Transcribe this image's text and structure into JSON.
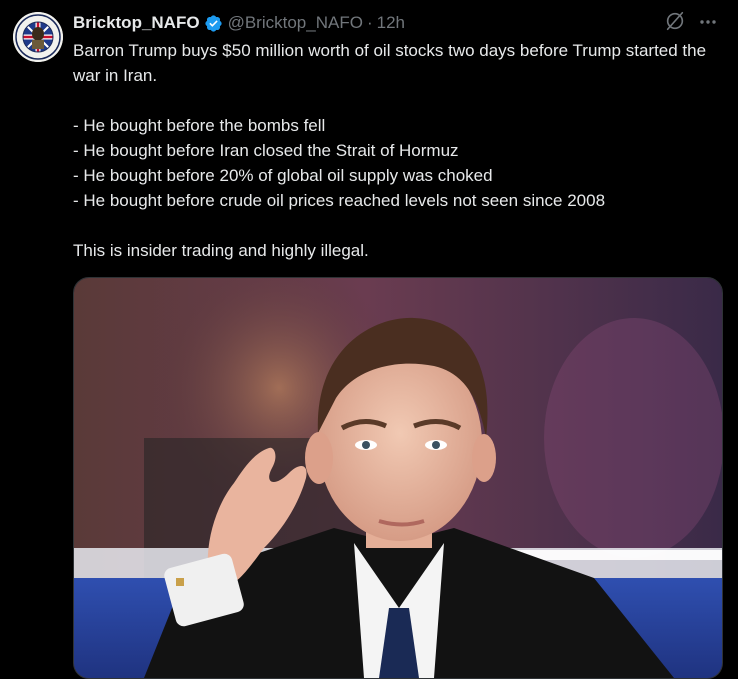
{
  "tweet": {
    "display_name": "Bricktop_NAFO",
    "handle": "@Bricktop_NAFO",
    "separator": "·",
    "timestamp": "12h",
    "lines": [
      "Barron Trump buys $50 million worth of oil stocks two days before Trump started the war in Iran.",
      "",
      "- He bought before the bombs fell",
      "- He bought before Iran closed the Strait of Hormuz",
      "- He bought before 20% of global oil supply was choked",
      "- He bought before crude oil prices reached levels not seen since 2008",
      "",
      "This is insider trading and highly illegal."
    ]
  },
  "icons": {
    "verified": "verified-badge-icon",
    "grok": "grok-icon",
    "more": "more-icon"
  },
  "colors": {
    "background": "#000000",
    "text": "#e7e9ea",
    "muted": "#71767b",
    "verified": "#1d9bf0"
  }
}
